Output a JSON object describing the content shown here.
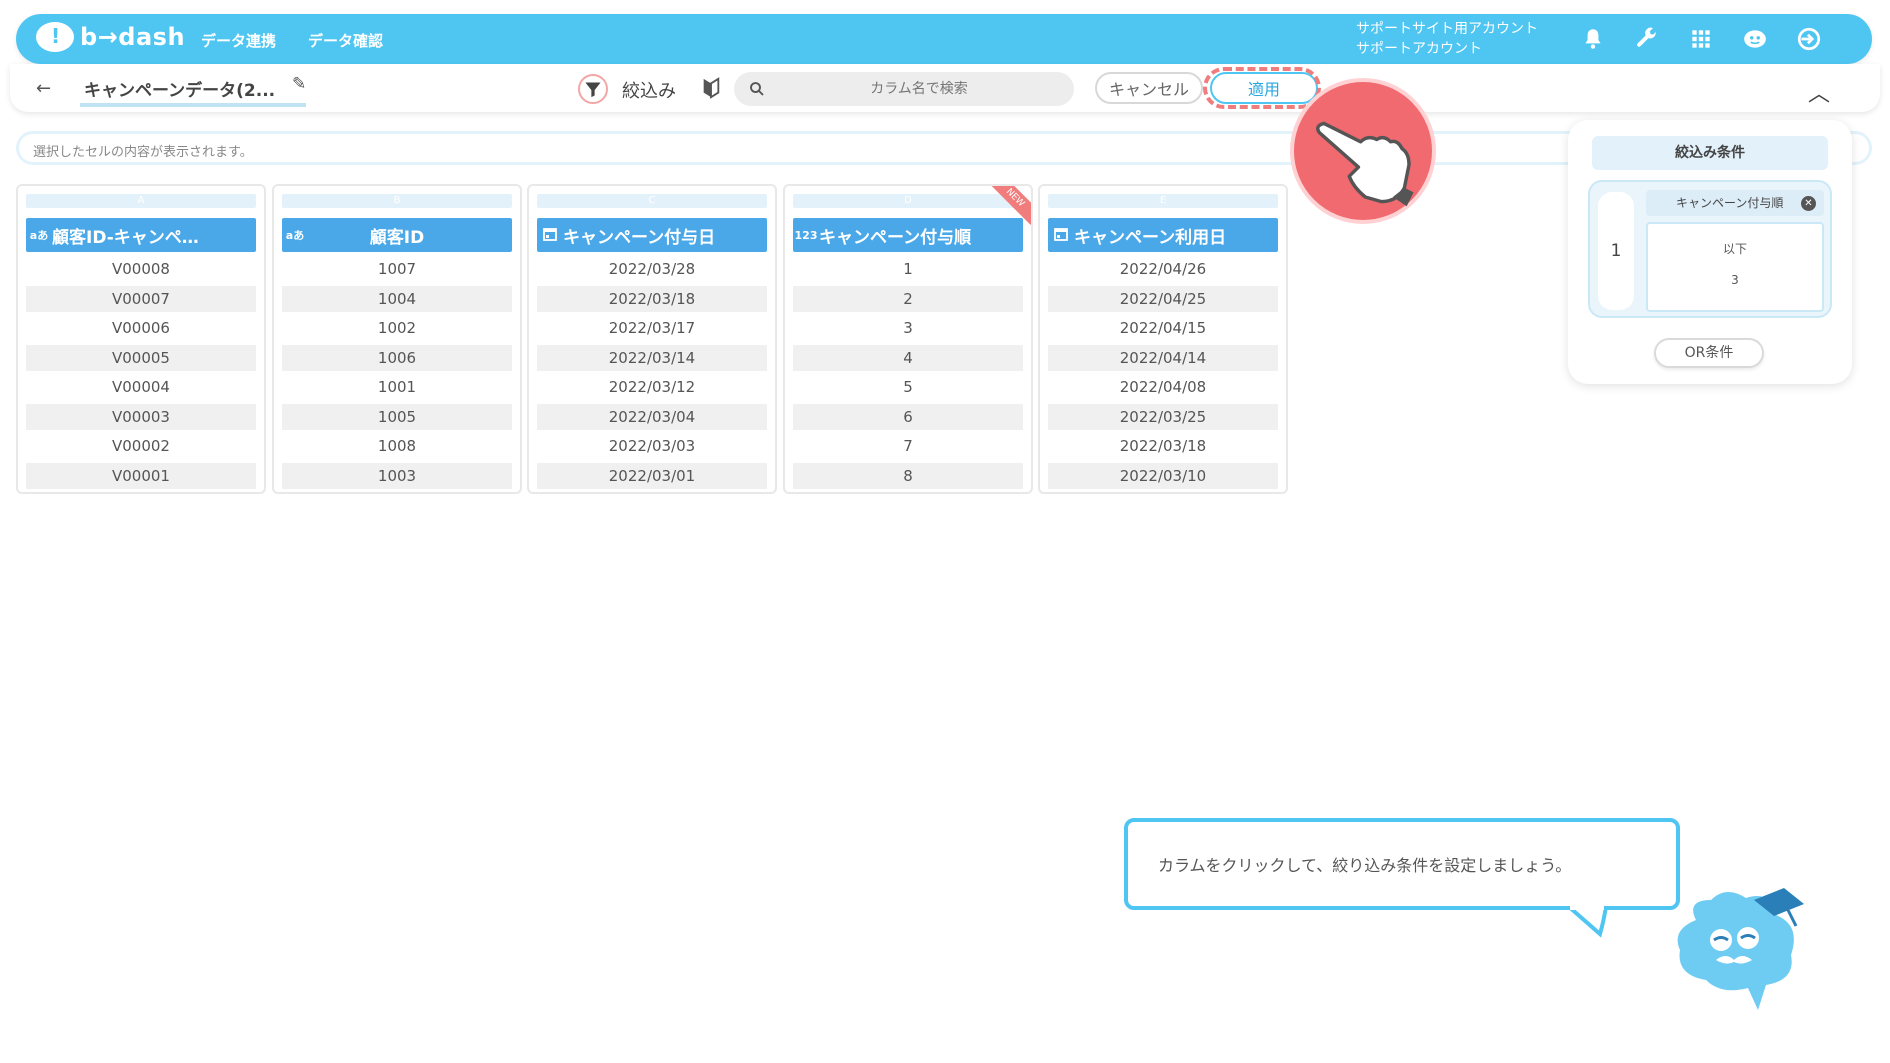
{
  "topbar": {
    "logo_text": "b→dash",
    "nav": [
      "データ連携",
      "データ確認"
    ],
    "account_line1": "サポートサイト用アカウント",
    "account_line2": "サポートアカウント",
    "icons": [
      "bell-icon",
      "wrench-icon",
      "grid-icon",
      "chat-bot-icon",
      "logout-icon"
    ]
  },
  "toolbar": {
    "title": "キャンペーンデータ(2...",
    "filter_label": "絞込み",
    "search_placeholder": "カラム名で検索",
    "cancel_label": "キャンセル",
    "apply_label": "適用"
  },
  "cellbar": {
    "text": "選択したセルの内容が表示されます。"
  },
  "columns": [
    {
      "letter": "A",
      "type": "aあ",
      "name": "顧客ID-キャンペ…",
      "cells": [
        "V00008",
        "V00007",
        "V00006",
        "V00005",
        "V00004",
        "V00003",
        "V00002",
        "V00001"
      ]
    },
    {
      "letter": "B",
      "type": "aあ",
      "name": "顧客ID",
      "cells": [
        "1007",
        "1004",
        "1002",
        "1006",
        "1001",
        "1005",
        "1008",
        "1003"
      ]
    },
    {
      "letter": "C",
      "type": "cal",
      "name": "キャンペーン付与日",
      "cells": [
        "2022/03/28",
        "2022/03/18",
        "2022/03/17",
        "2022/03/14",
        "2022/03/12",
        "2022/03/04",
        "2022/03/03",
        "2022/03/01"
      ]
    },
    {
      "letter": "D",
      "type": "123",
      "name": "キャンペーン付与順",
      "badge": "NEW",
      "cells": [
        "1",
        "2",
        "3",
        "4",
        "5",
        "6",
        "7",
        "8"
      ]
    },
    {
      "letter": "E",
      "type": "cal",
      "name": "キャンペーン利用日",
      "cells": [
        "2022/04/26",
        "2022/04/25",
        "2022/04/15",
        "2022/04/14",
        "2022/04/08",
        "2022/03/25",
        "2022/03/18",
        "2022/03/10"
      ]
    }
  ],
  "panel": {
    "title": "絞込み条件",
    "condition_number": "1",
    "condition_column": "キャンペーン付与順",
    "operator": "以下",
    "value": "3",
    "or_label": "OR条件"
  },
  "tutorial": {
    "message": "カラムをクリックして、絞り込み条件を設定しましょう。"
  },
  "colors": {
    "brand": "#4fc6f2",
    "header": "#4aa8e8",
    "highlight": "#f06a70"
  }
}
